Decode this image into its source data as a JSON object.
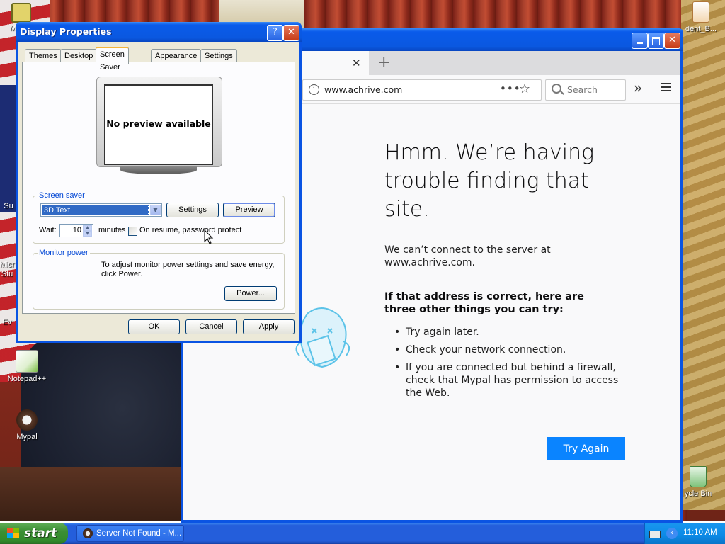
{
  "desktop": {
    "icons": [
      {
        "name": "desktop-icon-my-computer",
        "label": "M"
      },
      {
        "name": "desktop-icon-notepadpp",
        "label": "Notepad++"
      },
      {
        "name": "desktop-icon-mypal",
        "label": "Mypal"
      },
      {
        "name": "desktop-icon-document",
        "label": "dent_B..."
      },
      {
        "name": "desktop-icon-recycle-bin",
        "label": "ycle Bin"
      }
    ],
    "partial_labels": {
      "label_1": "Su",
      "label_2": "Micr",
      "label_3": "Stu",
      "label_4": "Ev"
    }
  },
  "browser": {
    "tab_close": "✕",
    "new_tab": "+",
    "url": "www.achrive.com",
    "page_actions": "•••",
    "search_placeholder": "Search",
    "overflow": "»",
    "error": {
      "title": "Hmm. We’re having trouble finding that site.",
      "description": "We can’t connect to the server at www.achrive.com.",
      "suggestion_heading": "If that address is correct, here are three other things you can try:",
      "suggestions": [
        "Try again later.",
        "Check your network connection.",
        "If you are connected but behind a firewall, check that Mypal has permission to access the Web."
      ],
      "try_again": "Try Again"
    },
    "colors": {
      "accent": "#0a84ff",
      "titlebar": "#0a58e0"
    }
  },
  "dialog": {
    "title": "Display Properties",
    "help": "?",
    "close": "✕",
    "tabs": [
      "Themes",
      "Desktop",
      "Screen Saver",
      "Appearance",
      "Settings"
    ],
    "active_tab": "Screen Saver",
    "preview_text": "No preview available",
    "screensaver_group": "Screen saver",
    "screensaver_value": "3D Text",
    "settings_button": "Settings",
    "preview_button": "Preview",
    "wait_label": "Wait:",
    "wait_value": "10",
    "minutes_label": "minutes",
    "password_label": "On resume, password protect",
    "power_group": "Monitor power",
    "power_text": "To adjust monitor power settings and save energy, click Power.",
    "power_button": "Power...",
    "ok": "OK",
    "cancel": "Cancel",
    "apply": "Apply"
  },
  "taskbar": {
    "start": "start",
    "task_item": "Server Not Found - M...",
    "clock": "11:10 AM"
  }
}
